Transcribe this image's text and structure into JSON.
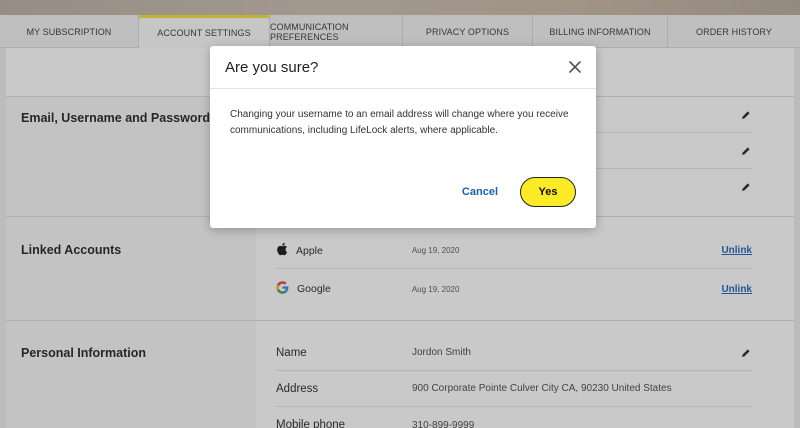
{
  "tabs": [
    {
      "label": "MY SUBSCRIPTION"
    },
    {
      "label": "ACCOUNT SETTINGS"
    },
    {
      "label": "COMMUNICATION PREFERENCES"
    },
    {
      "label": "PRIVACY OPTIONS"
    },
    {
      "label": "BILLING INFORMATION"
    },
    {
      "label": "ORDER HISTORY"
    }
  ],
  "sections": {
    "email": {
      "title": "Email, Username and Password"
    },
    "linked": {
      "title": "Linked Accounts",
      "accounts": [
        {
          "name": "Apple",
          "date": "Aug 19, 2020",
          "action": "Unlink"
        },
        {
          "name": "Google",
          "date": "Aug 19, 2020",
          "action": "Unlink"
        }
      ]
    },
    "personal": {
      "title": "Personal Information",
      "rows": [
        {
          "label": "Name",
          "value": "Jordon Smith"
        },
        {
          "label": "Address",
          "value": "900 Corporate Pointe Culver City CA, 90230 United States"
        },
        {
          "label": "Mobile phone",
          "value": "310-899-9999"
        }
      ]
    }
  },
  "modal": {
    "title": "Are you sure?",
    "message": "Changing your username to an email address will change where you receive communications, including LifeLock alerts, where applicable.",
    "cancel_label": "Cancel",
    "confirm_label": "Yes"
  },
  "colors": {
    "accent_yellow": "#fcea26",
    "link_blue": "#1b5fb8",
    "active_tab_border": "#f5e03a"
  }
}
